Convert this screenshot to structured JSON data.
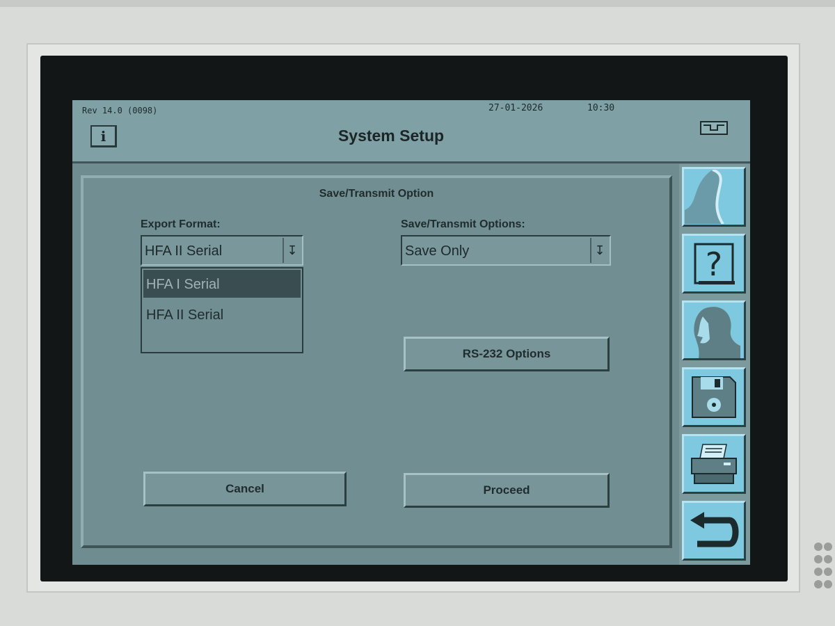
{
  "status": {
    "revision": "Rev 14.0 (0098)",
    "date": "27-01-2026",
    "time": "10:30"
  },
  "header": {
    "title": "System Setup",
    "info_label": "i"
  },
  "dialog": {
    "title": "Save/Transmit Option",
    "export_format": {
      "label": "Export Format:",
      "value": "HFA II Serial",
      "options": [
        "HFA I Serial",
        "HFA II Serial"
      ],
      "highlighted": "HFA I Serial"
    },
    "save_transmit": {
      "label": "Save/Transmit Options:",
      "value": "Save Only"
    },
    "rs232_label": "RS-232 Options",
    "cancel_label": "Cancel",
    "proceed_label": "Proceed"
  },
  "sidebar": {
    "items": [
      "wave-icon",
      "help-icon",
      "patient-icon",
      "floppy-disk-icon",
      "printer-icon",
      "return-icon"
    ]
  },
  "colors": {
    "screen": "#6f8d91",
    "toolbar_button": "#7ec9df",
    "selection": "#3a4d50"
  }
}
